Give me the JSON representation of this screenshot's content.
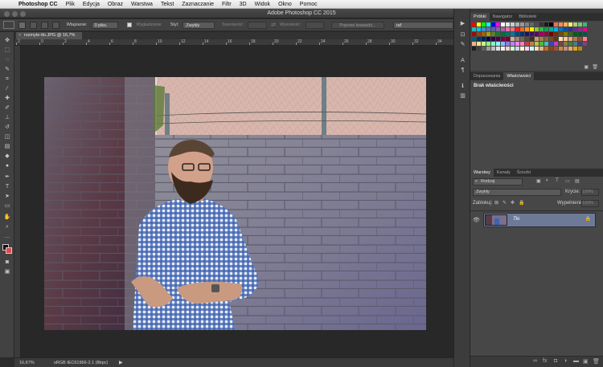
{
  "menubar": {
    "app_name": "Photoshop CC",
    "items": [
      "Plik",
      "Edycja",
      "Obraz",
      "Warstwa",
      "Tekst",
      "Zaznaczanie",
      "Filtr",
      "3D",
      "Widok",
      "Okno",
      "Pomoc"
    ]
  },
  "window": {
    "title": "Adobe Photoshop CC 2015"
  },
  "options_bar": {
    "feather_label": "Wtapianie:",
    "feather_value": "0 piks.",
    "antialias_label": "Wygładzanie",
    "style_label": "Styl:",
    "style_value": "Zwykły",
    "width_label": "Szerokość:",
    "height_label": "Wysokość:",
    "refine_button": "Popraw krawędź...",
    "workspace_value": "raf"
  },
  "document": {
    "tab_label": "rozmyte-tło.JPG @ 16,7% (RGB/8)",
    "ruler_marks": [
      "2",
      "0",
      "2",
      "4",
      "6",
      "8",
      "10",
      "12",
      "14",
      "16",
      "18",
      "20",
      "22",
      "24",
      "26",
      "28",
      "30",
      "32",
      "34"
    ]
  },
  "status_bar": {
    "zoom": "16,67%",
    "profile": "sRGB IEC61966-2.1 (8bpc)"
  },
  "swatches_panel": {
    "tabs": [
      "Próbki",
      "Nawigator",
      "Biblioteki"
    ],
    "active_tab": "Próbki"
  },
  "properties_panel": {
    "tabs": [
      "Dopasowania",
      "Właściwości"
    ],
    "active_tab": "Właściwości",
    "empty_text": "Brak właściwości"
  },
  "layers_panel": {
    "tabs": [
      "Warstwy",
      "Kanały",
      "Ścieżki"
    ],
    "active_tab": "Warstwy",
    "filter_value": "Rodzaj",
    "blend_mode": "Zwykły",
    "opacity_label": "Krycie:",
    "opacity_value": "100%",
    "lock_label": "Zablokuj:",
    "fill_label": "Wypełnienie:",
    "fill_value": "100%",
    "layers": [
      {
        "name": "Tło",
        "visible": true,
        "locked": true
      }
    ]
  },
  "colors": {
    "swatch_colors": [
      "#ff0000",
      "#ffff00",
      "#00ff00",
      "#00ffff",
      "#0000ff",
      "#ff00ff",
      "#ffffff",
      "#e6e6e6",
      "#cccccc",
      "#b3b3b3",
      "#999999",
      "#808080",
      "#666666",
      "#4d4d4d",
      "#333333",
      "#1a1a1a",
      "#000000",
      "#f26c4f",
      "#f68e56",
      "#fbaf5c",
      "#fff467",
      "#acd372",
      "#7cc576",
      "#3bb878",
      "#1abbb4",
      "#00bff3",
      "#438ccb",
      "#5574b9",
      "#605ca8",
      "#855fa8",
      "#a763a8",
      "#f06ea9",
      "#f26d7d",
      "#ed1c24",
      "#f26522",
      "#f7941d",
      "#fff200",
      "#8dc63f",
      "#39b54a",
      "#00a651",
      "#00a99d",
      "#00aeef",
      "#0072bc",
      "#0054a6",
      "#2e3192",
      "#662d91",
      "#92278f",
      "#ec008c",
      "#9e0b0f",
      "#a0410d",
      "#a3620a",
      "#aba000",
      "#598527",
      "#197b30",
      "#007236",
      "#00746b",
      "#0076a3",
      "#004b80",
      "#003471",
      "#1b1464",
      "#440e62",
      "#630460",
      "#9e005d",
      "#9e0039",
      "#790000",
      "#7b2e00",
      "#7d4900",
      "#827b00",
      "#406618",
      "#005e20",
      "#005826",
      "#005952",
      "#005b7f",
      "#003663",
      "#002157",
      "#0d004c",
      "#32004b",
      "#4b0049",
      "#7b0046",
      "#7a0026",
      "#c7b299",
      "#998675",
      "#736357",
      "#534741",
      "#37302d",
      "#c69c6d",
      "#a67c52",
      "#8c6239",
      "#754c24",
      "#603913",
      "#ffe0c0",
      "#ffc8a0",
      "#e0a878",
      "#b87850",
      "#905030",
      "#ff8080",
      "#ffb080",
      "#ffe080",
      "#c0ff80",
      "#80ff80",
      "#80ffc0",
      "#80ffff",
      "#80c0ff",
      "#8080ff",
      "#c080ff",
      "#ff80ff",
      "#ff80c0",
      "#c04040",
      "#c08040",
      "#c0c040",
      "#40c040",
      "#40c0c0",
      "#4040c0",
      "#c040c0",
      "#804040",
      "#808040",
      "#408040",
      "#408080",
      "#404080",
      "#804080",
      "#202020",
      "#404040",
      "#606060",
      "#a0a0a0",
      "#c0c0c0",
      "#e0e0e0",
      "#f0f0f0",
      "#ffd0d0",
      "#d0ffd0",
      "#d0d0ff",
      "#ffffd0",
      "#ffd0ff",
      "#d0ffff",
      "#f5deb3",
      "#deb887",
      "#d2691e",
      "#8b4513",
      "#a0522d",
      "#cd853f",
      "#bc8f8f",
      "#f4a460",
      "#daa520",
      "#b8860b"
    ],
    "fg": "#111111",
    "bg": "#e34a4a",
    "layer_selected": "#6c7a98"
  }
}
